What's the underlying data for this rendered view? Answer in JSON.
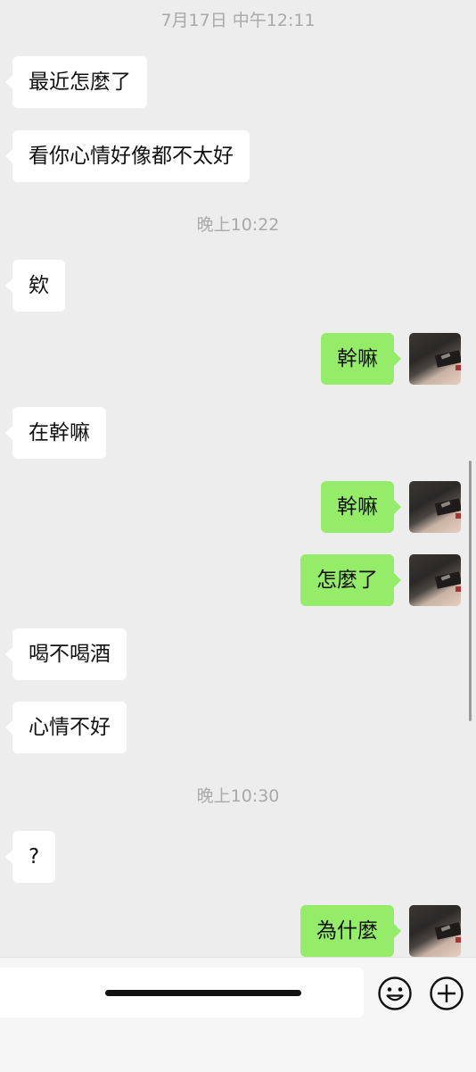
{
  "timestamps": {
    "t1": "7月17日 中午12:11",
    "t2": "晚上10:22",
    "t3": "晚上10:30"
  },
  "messages": [
    {
      "side": "in",
      "text": "最近怎麼了"
    },
    {
      "side": "in",
      "text": "看你心情好像都不太好"
    },
    {
      "side": "in",
      "text": "欸"
    },
    {
      "side": "out",
      "text": "幹嘛"
    },
    {
      "side": "in",
      "text": "在幹嘛"
    },
    {
      "side": "out",
      "text": "幹嘛"
    },
    {
      "side": "out",
      "text": "怎麼了"
    },
    {
      "side": "in",
      "text": "喝不喝酒"
    },
    {
      "side": "in",
      "text": "心情不好"
    },
    {
      "side": "in",
      "text": "?"
    },
    {
      "side": "out",
      "text": "為什麼"
    }
  ],
  "input": {
    "value": "",
    "icons": [
      "emoji-icon",
      "plus-icon"
    ]
  },
  "colors": {
    "background": "#ededed",
    "outgoing_bubble": "#95ec69",
    "incoming_bubble": "#ffffff",
    "timestamp_text": "#a9a9a9"
  }
}
